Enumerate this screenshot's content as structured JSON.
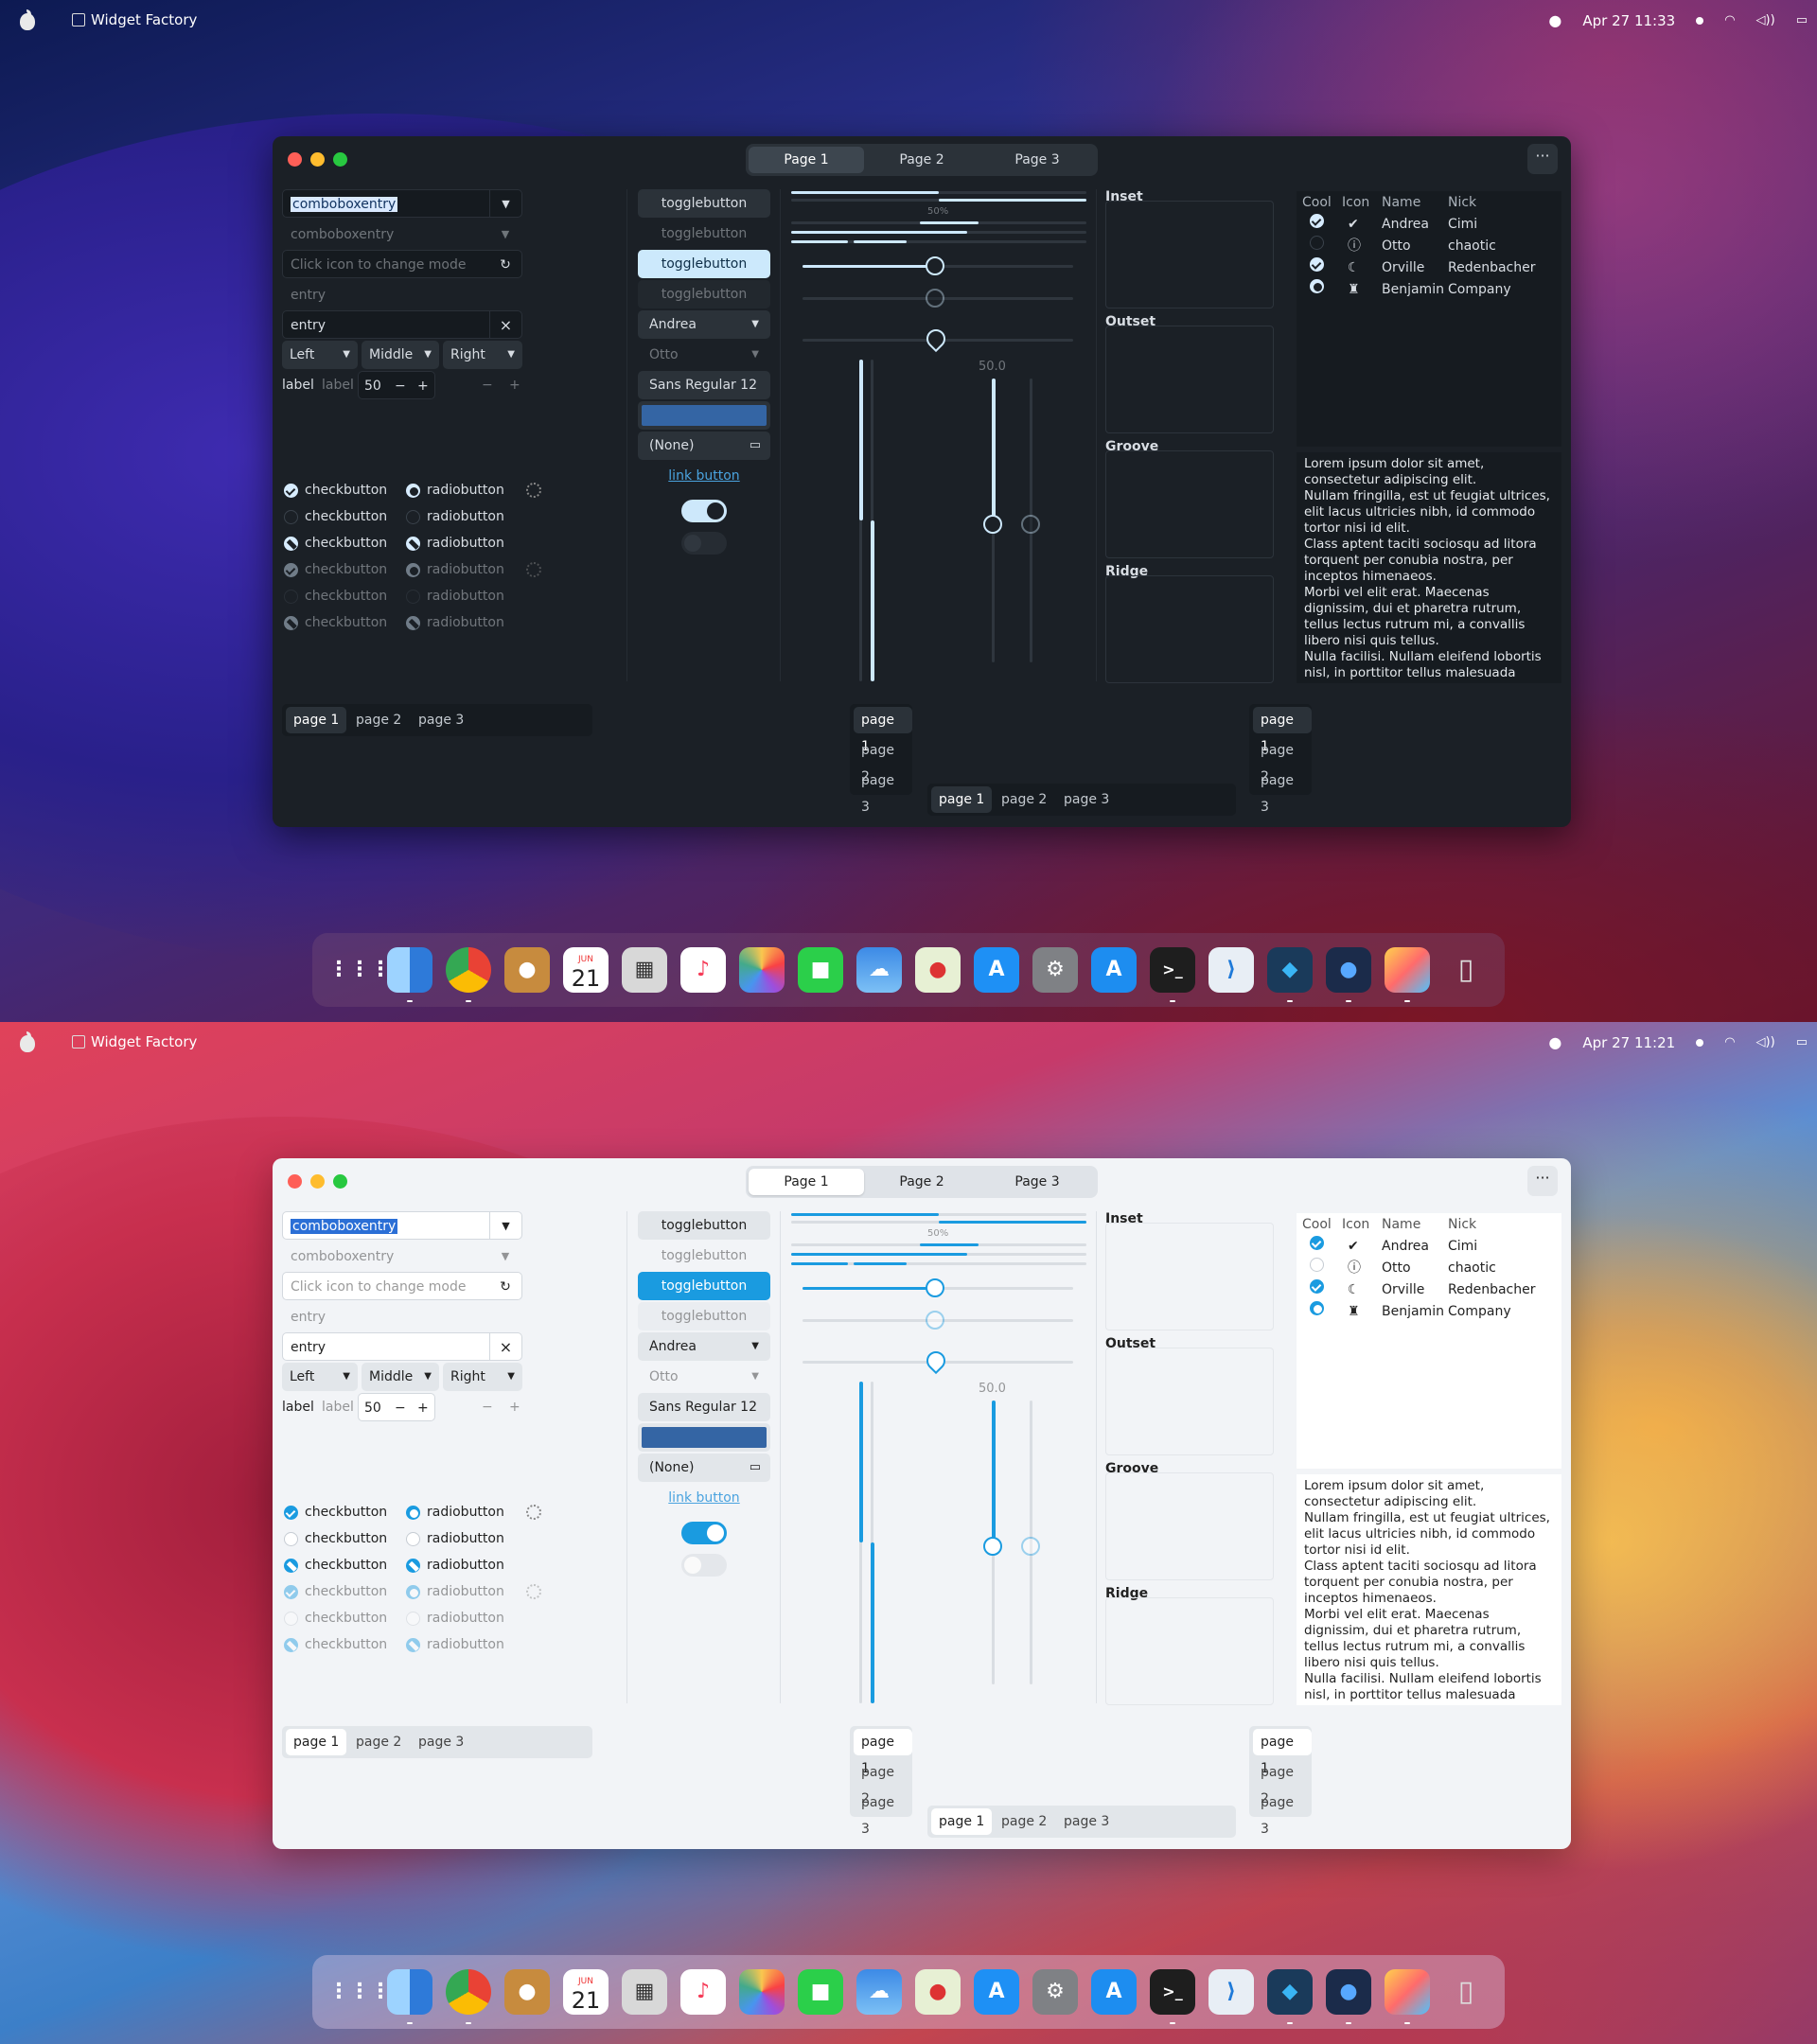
{
  "screens": [
    {
      "theme": "dark",
      "menubar": {
        "app": "Widget Factory",
        "clock": "Apr 27  11:33"
      }
    },
    {
      "theme": "light",
      "menubar": {
        "app": "Widget Factory",
        "clock": "Apr 27  11:21"
      }
    }
  ],
  "window": {
    "tabs": [
      "Page 1",
      "Page 2",
      "Page 3"
    ],
    "menu": "···",
    "combo1": "comboboxentry",
    "combo2": "comboboxentry",
    "entry_placeholder": "Click icon to change mode",
    "entry_flat": "entry",
    "entry_value": "entry",
    "entry_clear": "×",
    "align_left": "Left",
    "align_middle": "Middle",
    "align_right": "Right",
    "label1": "label",
    "label2": "label",
    "spin_value": "50",
    "spin_minus": "−",
    "spin_plus": "+",
    "checkbutton": "checkbutton",
    "radiobutton": "radiobutton",
    "togglebutton": "togglebutton",
    "combo_andrea": "Andrea",
    "combo_otto": "Otto",
    "font_name": "Sans Regular",
    "font_size": "12",
    "file_none": "(None)",
    "link": "link button",
    "progress_label": "50%",
    "scale_value": "50.0",
    "frames": [
      "Inset",
      "Outset",
      "Groove",
      "Ridge"
    ],
    "tree": {
      "headers": [
        "Cool",
        "Icon",
        "Name",
        "Nick"
      ],
      "rows": [
        [
          "Andrea",
          "Cimi"
        ],
        [
          "Otto",
          "chaotic"
        ],
        [
          "Orville",
          "Redenbacher"
        ],
        [
          "Benjamin",
          "Company"
        ]
      ]
    },
    "text": "Lorem ipsum dolor sit amet, consectetur adipiscing elit.\nNullam fringilla, est ut feugiat ultrices, elit lacus ultricies nibh, id commodo tortor nisi id elit.\nClass aptent taciti sociosqu ad litora torquent per conubia nostra, per inceptos himenaeos.\nMorbi vel elit erat. Maecenas dignissim, dui et pharetra rutrum, tellus lectus rutrum mi, a convallis libero nisi quis tellus.\nNulla facilisi. Nullam eleifend lobortis nisl, in porttitor tellus malesuada",
    "nb_pages": [
      "page 1",
      "page 2",
      "page 3"
    ]
  },
  "dock": [
    "launchpad-icon",
    "finder-icon",
    "chrome-icon",
    "contacts-icon",
    "calendar-icon",
    "calculator-icon",
    "music-icon",
    "photos-icon",
    "facetime-icon",
    "weather-icon",
    "maps-icon",
    "app-store-icon",
    "system-preferences-icon",
    "xcode-icon",
    "terminal-icon",
    "vscode-icon",
    "box-icon",
    "control-center-icon",
    "preview-icon",
    "trash-icon"
  ],
  "calendar": {
    "month": "JUN",
    "day": "21"
  },
  "colors": {
    "dark_bg": "#1b2026",
    "light_bg": "#f2f4f7",
    "accent_dark": "#cde8fb",
    "accent_light": "#1a9be0"
  }
}
